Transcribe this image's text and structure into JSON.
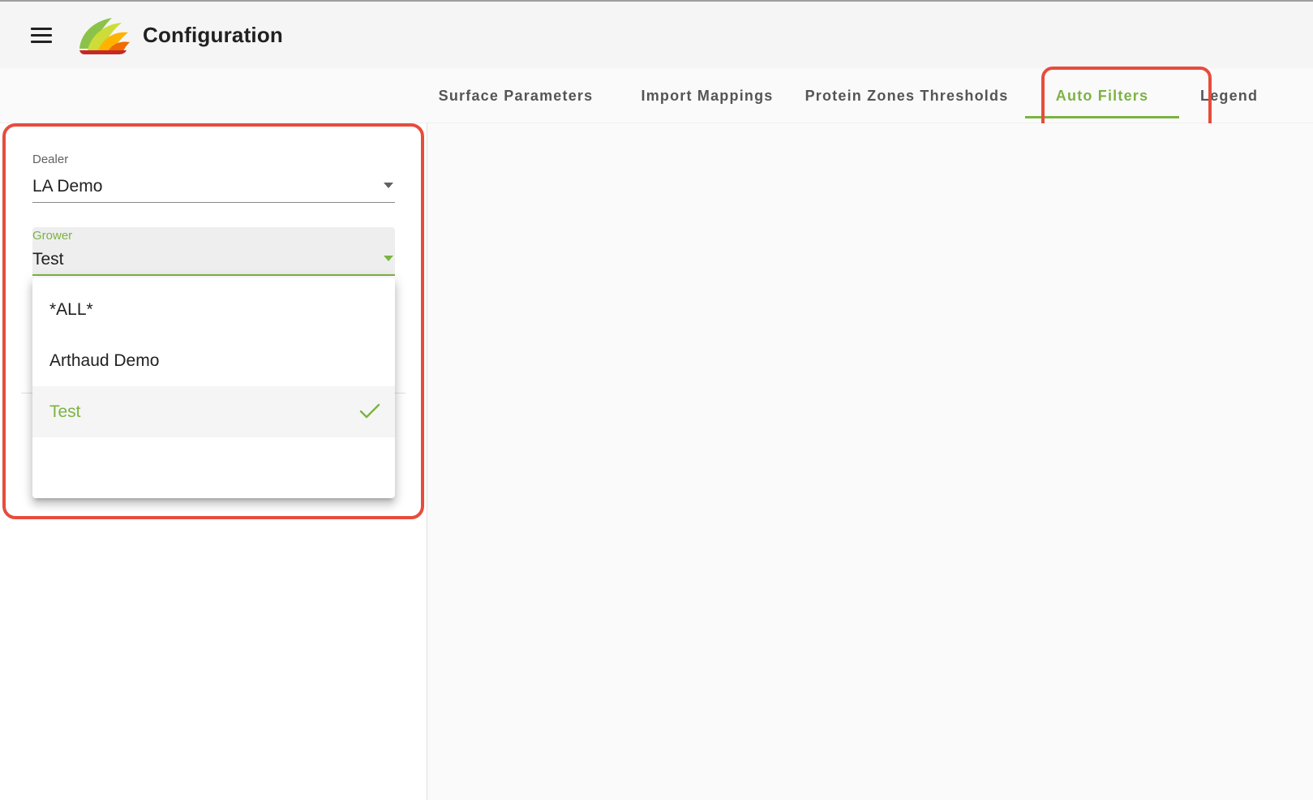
{
  "app": {
    "title": "Configuration",
    "brand_color": "#7cb342",
    "highlight_color": "#e74c3c"
  },
  "tabs": [
    {
      "label": "Surface Parameters",
      "active": false
    },
    {
      "label": "Import Mappings",
      "active": false
    },
    {
      "label": "Protein Zones Thresholds",
      "active": false
    },
    {
      "label": "Auto Filters",
      "active": true
    },
    {
      "label": "Legend",
      "active": false
    }
  ],
  "filters": {
    "dealer": {
      "label": "Dealer",
      "value": "LA Demo"
    },
    "grower": {
      "label": "Grower",
      "value": "Test"
    }
  },
  "grower_menu": {
    "options": [
      {
        "label": "*ALL*",
        "selected": false
      },
      {
        "label": "Arthaud Demo",
        "selected": false
      },
      {
        "label": "Test",
        "selected": true
      },
      {
        "label": "",
        "selected": false
      }
    ]
  },
  "icons": [
    "menu-icon",
    "app-logo",
    "chevron-down-icon",
    "check-icon"
  ]
}
